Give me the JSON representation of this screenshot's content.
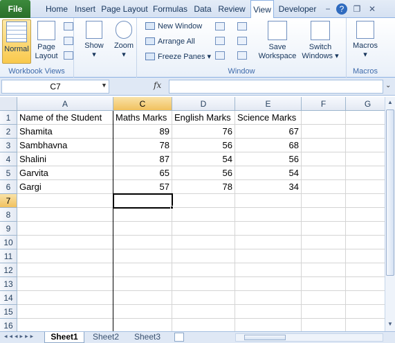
{
  "tabs": [
    "File",
    "Home",
    "Insert",
    "Page Layout",
    "Formulas",
    "Data",
    "Review",
    "View",
    "Developer"
  ],
  "window_buttons": [
    "−",
    "?",
    "❐",
    "✕"
  ],
  "ribbon": {
    "workbook_views": {
      "normal": "Normal",
      "page_layout_1": "Page",
      "page_layout_2": "Layout",
      "label": "Workbook Views"
    },
    "show": "Show",
    "zoom": "Zoom",
    "window": {
      "new_window": "New Window",
      "arrange_all": "Arrange All",
      "freeze_panes": "Freeze Panes",
      "save_1": "Save",
      "save_2": "Workspace",
      "switch_1": "Switch",
      "switch_2": "Windows",
      "label": "Window"
    },
    "macros": {
      "button": "Macros",
      "label": "Macros"
    }
  },
  "formula_bar": {
    "name_box": "C7",
    "fx": "fx",
    "formula": ""
  },
  "columns": [
    "A",
    "C",
    "D",
    "E",
    "F",
    "G"
  ],
  "rows": [
    "1",
    "2",
    "3",
    "4",
    "5",
    "6",
    "7",
    "8",
    "9",
    "10",
    "11",
    "12",
    "13",
    "14",
    "15",
    "16"
  ],
  "cells": [
    [
      "Name of the Student",
      "Maths Marks",
      "English Marks",
      "Science Marks"
    ],
    [
      "Shamita",
      "89",
      "76",
      "67"
    ],
    [
      "Sambhavna",
      "78",
      "56",
      "68"
    ],
    [
      "Shalini",
      "87",
      "54",
      "56"
    ],
    [
      "Garvita",
      "65",
      "56",
      "54"
    ],
    [
      "Gargi",
      "57",
      "78",
      "34"
    ]
  ],
  "sheets": [
    "Sheet1",
    "Sheet2",
    "Sheet3"
  ]
}
